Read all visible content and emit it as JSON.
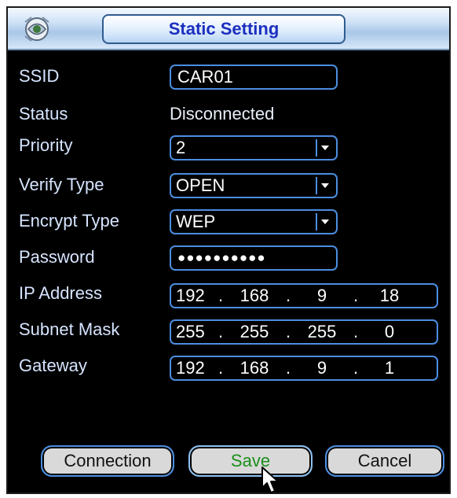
{
  "dialog": {
    "title": "Static Setting"
  },
  "fields": {
    "ssid": {
      "label": "SSID",
      "value": "CAR01"
    },
    "status": {
      "label": "Status",
      "value": "Disconnected"
    },
    "priority": {
      "label": "Priority",
      "value": "2"
    },
    "verify_type": {
      "label": "Verify Type",
      "value": "OPEN"
    },
    "encrypt_type": {
      "label": "Encrypt Type",
      "value": "WEP"
    },
    "password": {
      "label": "Password",
      "value": "●●●●●●●●●●"
    },
    "ip_address": {
      "label": "IP Address",
      "octets": [
        "192",
        "168",
        "9",
        "18"
      ]
    },
    "subnet_mask": {
      "label": "Subnet Mask",
      "octets": [
        "255",
        "255",
        "255",
        "0"
      ]
    },
    "gateway": {
      "label": "Gateway",
      "octets": [
        "192",
        "168",
        "9",
        "1"
      ]
    }
  },
  "buttons": {
    "connection": "Connection",
    "save": "Save",
    "cancel": "Cancel"
  },
  "icons": {
    "dropdown": "chevron-down-icon",
    "logo": "app-logo-icon",
    "cursor": "mouse-pointer-icon"
  },
  "colors": {
    "title_text": "#1b2fbf",
    "field_border": "#4b8ee0",
    "save_text": "#1a8f1a",
    "background": "#000000"
  }
}
